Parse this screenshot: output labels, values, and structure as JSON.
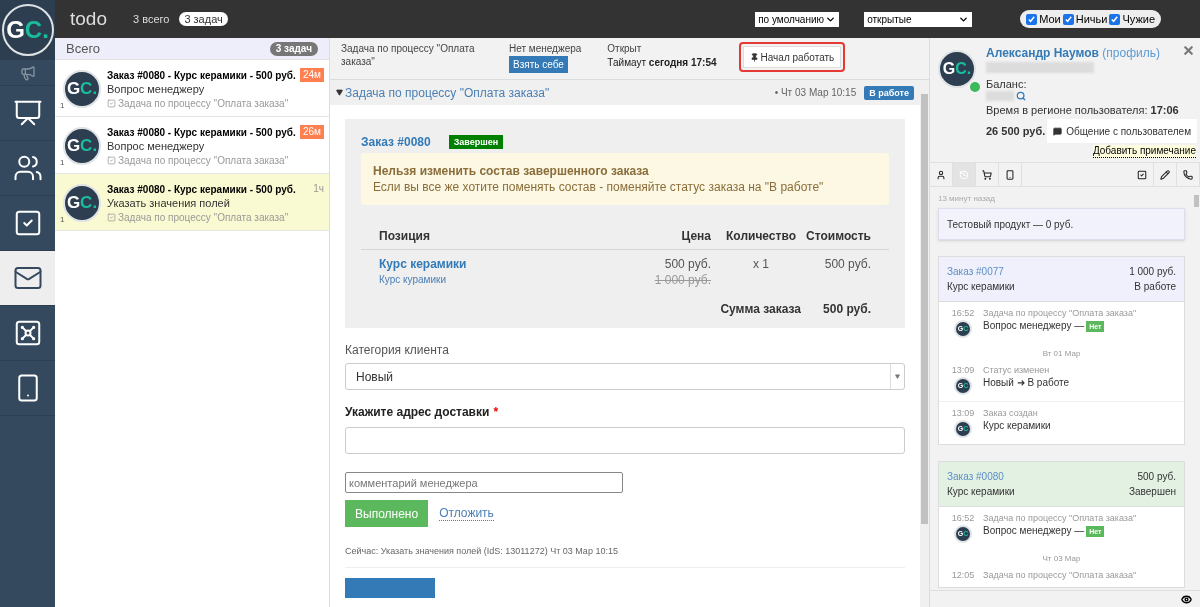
{
  "logo": "GC.",
  "nav": [
    {
      "kind": "megaphone",
      "selected": false
    },
    {
      "kind": "chart",
      "selected": false
    },
    {
      "kind": "people",
      "selected": false
    },
    {
      "kind": "tasks",
      "selected": false
    },
    {
      "kind": "mail",
      "selected": true
    },
    {
      "kind": "safe",
      "selected": false
    },
    {
      "kind": "phone",
      "selected": false
    }
  ],
  "top_bar": {
    "title": "todo",
    "total": "3 всего",
    "count_pill": "3 задач",
    "sort_select": "по умолчанию",
    "status_select": "открытые",
    "filters": [
      {
        "label": "Мои",
        "checked": true
      },
      {
        "label": "Ничьи",
        "checked": true
      },
      {
        "label": "Чужие",
        "checked": true
      }
    ]
  },
  "task_list": {
    "header": "Всего",
    "count": "3 задач",
    "items": [
      {
        "avatar": "GC.",
        "title": "Заказ #0080 - Курс керамики - 500 руб.",
        "subtitle": "Вопрос менеджеру",
        "process": "Задача по процессу \"Оплата заказа\"",
        "count": "1",
        "age": "24м",
        "overdue": true,
        "selected": false
      },
      {
        "avatar": "GC.",
        "title": "Заказ #0080 - Курс керамики - 500 руб.",
        "subtitle": "Вопрос менеджеру",
        "process": "Задача по процессу \"Оплата заказа\"",
        "count": "1",
        "age": "26м",
        "overdue": true,
        "selected": false
      },
      {
        "avatar": "GC.",
        "title": "Заказ #0080 - Курс керамики - 500 руб.",
        "subtitle": "Указать значения полей",
        "process": "Задача по процессу \"Оплата заказа\"",
        "count": "1",
        "age": "1ч",
        "overdue": false,
        "selected": true
      }
    ]
  },
  "task_header": {
    "process": "Задача по процессу \"Оплата заказа\"",
    "manager": "Нет менеджера",
    "take_button": "Взять себе",
    "state": "Открыт",
    "timeout": "Таймаут **сегодня 17:54**",
    "start_button": "Начал работать",
    "start_highlighted": true
  },
  "task": {
    "title": "Задача по процессу \"Оплата заказа\"",
    "expanded": true,
    "date": "• Чт 03 Мар 10:15",
    "status": "В работе",
    "order": {
      "number": "Заказ #0080",
      "status": "Завершен",
      "warning_title": "Нельзя изменить состав завершенного заказа",
      "warning_text": "Если вы все же хотите поменять состав - поменяйте статус заказа на \"В работе\"",
      "columns": [
        "Позиция",
        "Цена",
        "Количество",
        "Стоимость"
      ],
      "rows": [
        {
          "name": "Курс керамики",
          "description": "Курс курамики",
          "price": "500 руб.",
          "old_price": "1 000 руб.",
          "quantity": "x 1",
          "cost": "500 руб."
        }
      ],
      "total_label": "Сумма заказа",
      "total": "500 руб."
    },
    "category_label": "Категория клиента",
    "category_value": "Новый",
    "address_label": "Укажите адрес доставки",
    "address_required": true,
    "required_mark": "*",
    "comment_placeholder": "комментарий менеджера",
    "done_button": "Выполнено",
    "postpone_link": "Отложить",
    "current": "Сейчас: Указать значения полей (IdS: 13011272) Чт 03 Мар 10:15"
  },
  "user": {
    "avatar": "GC.",
    "online": true,
    "name": "Александр Наумов",
    "profile_link": "(профиль)",
    "balance_label": "Баланс:",
    "region_time": "Время в регионе пользователя: **17:06**",
    "amount": "26 500 руб.",
    "chat_button": "Общение с пользователем",
    "note_link": "Добавить примечание"
  },
  "user_tabs": [
    {
      "kind": "user",
      "selected": false
    },
    {
      "kind": "history",
      "selected": true
    },
    {
      "kind": "cart",
      "selected": false
    },
    {
      "kind": "phone",
      "selected": false
    },
    {
      "kind": "check",
      "selected": false
    },
    {
      "kind": "pencil",
      "selected": false
    },
    {
      "kind": "call",
      "selected": false
    }
  ],
  "feed": {
    "ago": "13 минут назад",
    "product": "Тестовый продукт — 0 руб.",
    "orders": [
      {
        "number": "Заказ #0077",
        "price": "1 000 руб.",
        "item": "Курс керамики",
        "status": "В работе",
        "done": false,
        "events": [
          {
            "kind": "event",
            "time": "16:52",
            "title": "Задача по процессу \"Оплата заказа\"",
            "text": "Вопрос менеджеру —",
            "badge": "Нет",
            "avatar": "GC"
          },
          {
            "kind": "date",
            "text": "Вт 01 Мар"
          },
          {
            "kind": "event",
            "time": "13:09",
            "title": "Статус изменен",
            "text": "Новый ➜ В работе",
            "avatar": "GC"
          },
          {
            "kind": "event",
            "time": "13:09",
            "title": "Заказ создан",
            "text": "Курс керамики",
            "avatar": "GC"
          }
        ]
      },
      {
        "number": "Заказ #0080",
        "price": "500 руб.",
        "item": "Курс керамики",
        "status": "Завершен",
        "done": true,
        "events": [
          {
            "kind": "event",
            "time": "16:52",
            "title": "Задача по процессу \"Оплата заказа\"",
            "text": "Вопрос менеджеру —",
            "badge": "Нет",
            "avatar": "GC"
          },
          {
            "kind": "date",
            "text": "Чт 03 Мар"
          },
          {
            "kind": "event",
            "time": "12:05",
            "title": "Задача по процессу \"Оплата заказа\""
          }
        ]
      }
    ]
  }
}
